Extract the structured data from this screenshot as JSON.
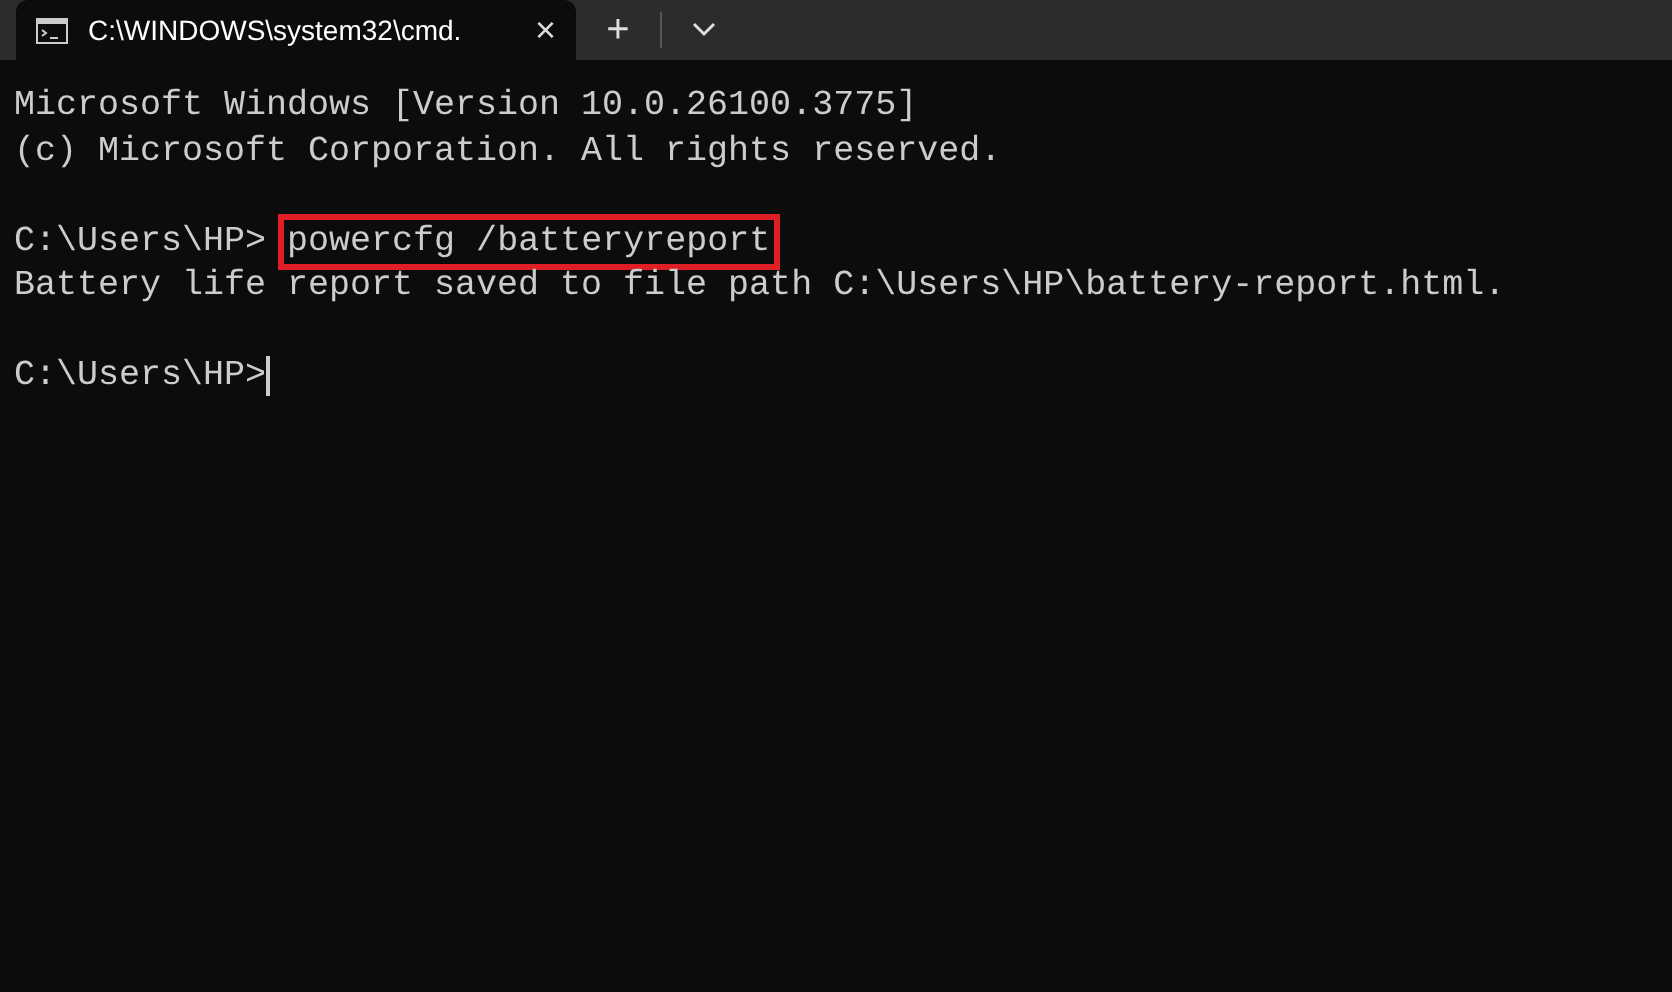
{
  "tabs": [
    {
      "title": "C:\\WINDOWS\\system32\\cmd.",
      "selected": true,
      "close": "×"
    }
  ],
  "new_tab": "+",
  "lines": [
    {
      "kind": "output",
      "text": "Microsoft Windows [Version 10.0.26100.3775]"
    },
    {
      "kind": "output",
      "text": "(c) Microsoft Corporation. All rights reserved."
    },
    {
      "kind": "blank"
    },
    {
      "kind": "prompt",
      "prompt": "C:\\Users\\HP>",
      "command": "powercfg /batteryreport",
      "highlighted": true
    },
    {
      "kind": "output",
      "text": "Battery life report saved to file path C:\\Users\\HP\\battery-report.html."
    },
    {
      "kind": "blank"
    },
    {
      "kind": "input",
      "prompt": "C:\\Users\\HP>",
      "cursor": true
    }
  ]
}
